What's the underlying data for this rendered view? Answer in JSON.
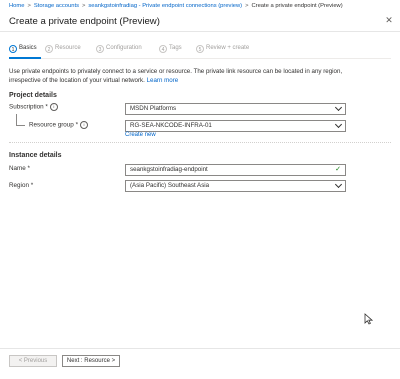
{
  "breadcrumb": {
    "items": [
      "Home",
      "Storage accounts",
      "seankgstoinfradiag - Private endpoint connections (preview)",
      "Create a private endpoint (Preview)"
    ]
  },
  "page": {
    "title": "Create a private endpoint (Preview)",
    "close_icon": "close-icon"
  },
  "steps": [
    {
      "num": "1",
      "label": "Basics"
    },
    {
      "num": "2",
      "label": "Resource"
    },
    {
      "num": "3",
      "label": "Configuration"
    },
    {
      "num": "4",
      "label": "Tags"
    },
    {
      "num": "5",
      "label": "Review + create"
    }
  ],
  "intro": {
    "text": "Use private endpoints to privately connect to a service or resource. The private link resource can be located in any region, irrespective of the location of your virtual network.",
    "link": "Learn more"
  },
  "project_details": {
    "title": "Project details",
    "subscription_label": "Subscription",
    "subscription_value": "MSDN Platforms",
    "resource_group_label": "Resource group",
    "resource_group_value": "RG-SEA-NKCODE-INFRA-01",
    "create_new": "Create new"
  },
  "instance_details": {
    "title": "Instance details",
    "name_label": "Name",
    "name_value": "seankgstoinfradiag-endpoint",
    "region_label": "Region",
    "region_value": "(Asia Pacific) Southeast Asia"
  },
  "footer": {
    "previous": "< Previous",
    "next": "Next : Resource >"
  },
  "colors": {
    "accent": "#0078d4",
    "link": "#0064c8",
    "valid": "#107c10"
  }
}
